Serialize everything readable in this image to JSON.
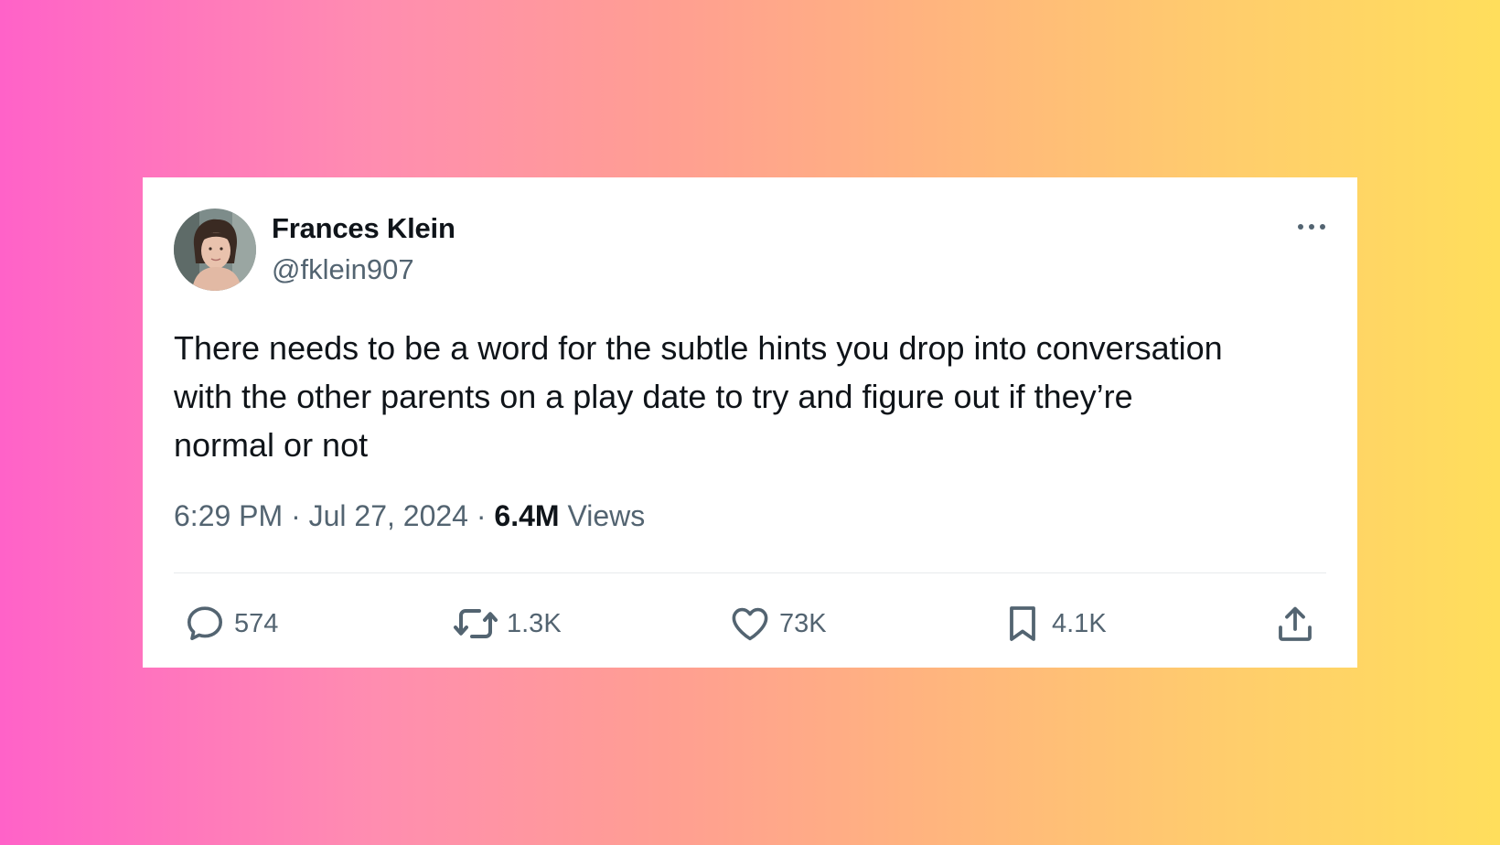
{
  "author": {
    "display_name": "Frances Klein",
    "handle": "@fklein907"
  },
  "tweet": {
    "text": "There needs to be a word for the subtle hints you drop into conversation\nwith the other parents on a play date to try and figure out if they’re\nnormal or not",
    "time": "6:29 PM",
    "date": "Jul 27, 2024",
    "views_count": "6.4M",
    "views_label": "Views",
    "separator": "·"
  },
  "actions": {
    "replies": "574",
    "reposts": "1.3K",
    "likes": "73K",
    "bookmarks": "4.1K"
  },
  "icons": {
    "more": "more-horizontal-icon",
    "reply": "reply-icon",
    "repost": "repost-icon",
    "like": "heart-icon",
    "bookmark": "bookmark-icon",
    "share": "share-icon"
  },
  "colors": {
    "text_primary": "#0f1419",
    "text_secondary": "#536471",
    "card_background": "#ffffff",
    "gradient_left": "#ff62c8",
    "gradient_right": "#ffde5c"
  }
}
